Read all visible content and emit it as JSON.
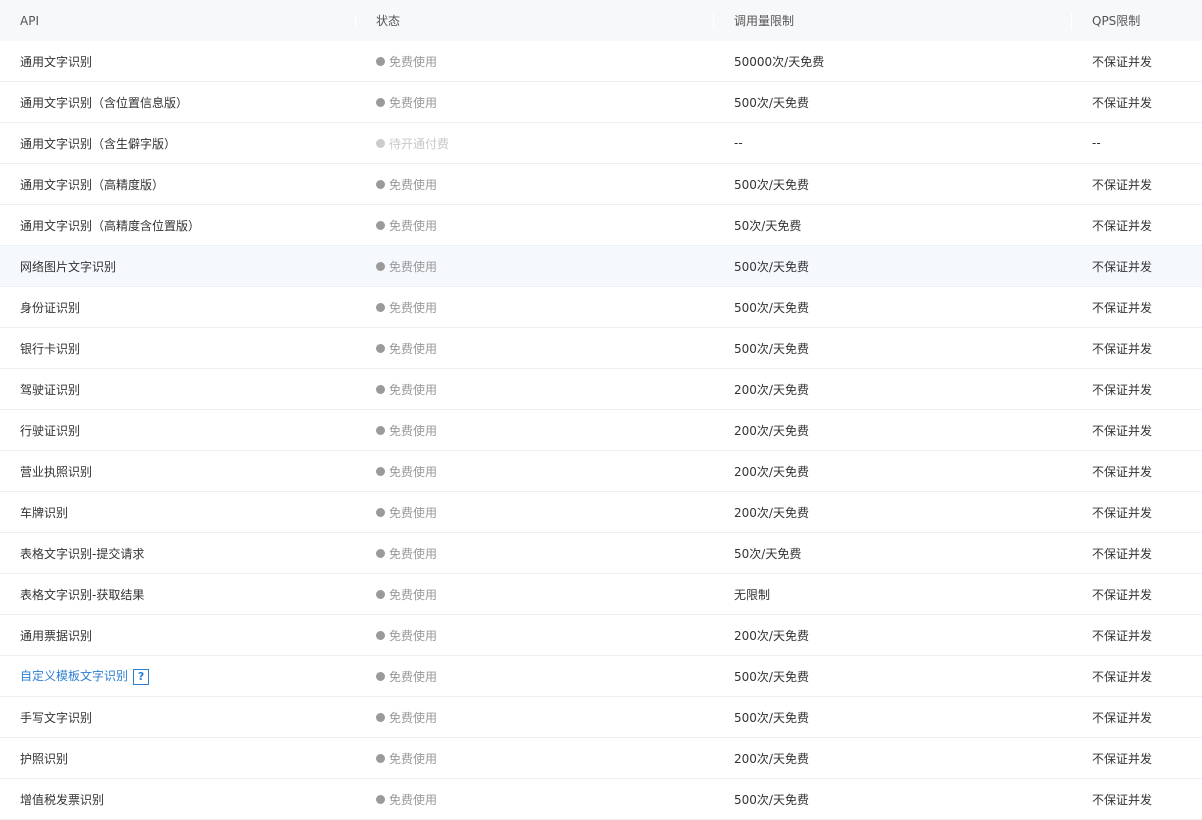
{
  "header": {
    "api": "API",
    "status": "状态",
    "limit": "调用量限制",
    "qps": "QPS限制"
  },
  "rows": [
    {
      "api": "通用文字识别",
      "status": "免费使用",
      "limit": "50000次/天免费",
      "qps": "不保证并发"
    },
    {
      "api": "通用文字识别（含位置信息版）",
      "status": "免费使用",
      "limit": "500次/天免费",
      "qps": "不保证并发"
    },
    {
      "api": "通用文字识别（含生僻字版）",
      "status": "待开通付费",
      "limit": "--",
      "qps": "--",
      "pending": true
    },
    {
      "api": "通用文字识别（高精度版）",
      "status": "免费使用",
      "limit": "500次/天免费",
      "qps": "不保证并发"
    },
    {
      "api": "通用文字识别（高精度含位置版）",
      "status": "免费使用",
      "limit": "50次/天免费",
      "qps": "不保证并发"
    },
    {
      "api": "网络图片文字识别",
      "status": "免费使用",
      "limit": "500次/天免费",
      "qps": "不保证并发",
      "hover": true
    },
    {
      "api": "身份证识别",
      "status": "免费使用",
      "limit": "500次/天免费",
      "qps": "不保证并发"
    },
    {
      "api": "银行卡识别",
      "status": "免费使用",
      "limit": "500次/天免费",
      "qps": "不保证并发"
    },
    {
      "api": "驾驶证识别",
      "status": "免费使用",
      "limit": "200次/天免费",
      "qps": "不保证并发"
    },
    {
      "api": "行驶证识别",
      "status": "免费使用",
      "limit": "200次/天免费",
      "qps": "不保证并发"
    },
    {
      "api": "营业执照识别",
      "status": "免费使用",
      "limit": "200次/天免费",
      "qps": "不保证并发"
    },
    {
      "api": "车牌识别",
      "status": "免费使用",
      "limit": "200次/天免费",
      "qps": "不保证并发"
    },
    {
      "api": "表格文字识别-提交请求",
      "status": "免费使用",
      "limit": "50次/天免费",
      "qps": "不保证并发"
    },
    {
      "api": "表格文字识别-获取结果",
      "status": "免费使用",
      "limit": "无限制",
      "qps": "不保证并发"
    },
    {
      "api": "通用票据识别",
      "status": "免费使用",
      "limit": "200次/天免费",
      "qps": "不保证并发"
    },
    {
      "api": "自定义模板文字识别",
      "status": "免费使用",
      "limit": "500次/天免费",
      "qps": "不保证并发",
      "link": true,
      "help": "?"
    },
    {
      "api": "手写文字识别",
      "status": "免费使用",
      "limit": "500次/天免费",
      "qps": "不保证并发"
    },
    {
      "api": "护照识别",
      "status": "免费使用",
      "limit": "200次/天免费",
      "qps": "不保证并发"
    },
    {
      "api": "增值税发票识别",
      "status": "免费使用",
      "limit": "500次/天免费",
      "qps": "不保证并发"
    }
  ],
  "colors": {
    "link": "#2d7fd3",
    "status_dot": "#9a9a9a",
    "pending_dot": "#cccccc"
  }
}
